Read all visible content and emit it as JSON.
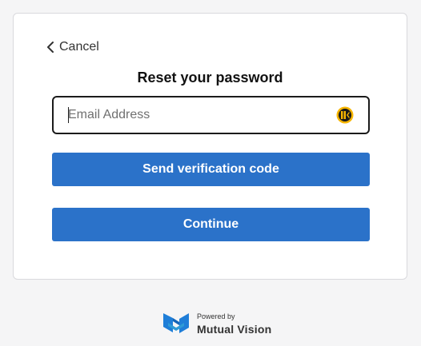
{
  "header": {
    "cancel_label": "Cancel",
    "title": "Reset your password"
  },
  "form": {
    "email_placeholder": "Email Address",
    "email_value": "",
    "send_code_label": "Send verification code",
    "continue_label": "Continue"
  },
  "footer": {
    "powered_by": "Powered by",
    "brand": "Mutual Vision"
  },
  "icons": {
    "back": "chevron-left-icon",
    "password_manager": "keeper-icon",
    "brand_logo": "mutual-vision-logo"
  },
  "colors": {
    "primary_button": "#2b72c9",
    "background": "#f5f5f6",
    "card": "#ffffff",
    "brand_blue": "#1f7ed8",
    "brand_teal": "#2f9bd6"
  }
}
